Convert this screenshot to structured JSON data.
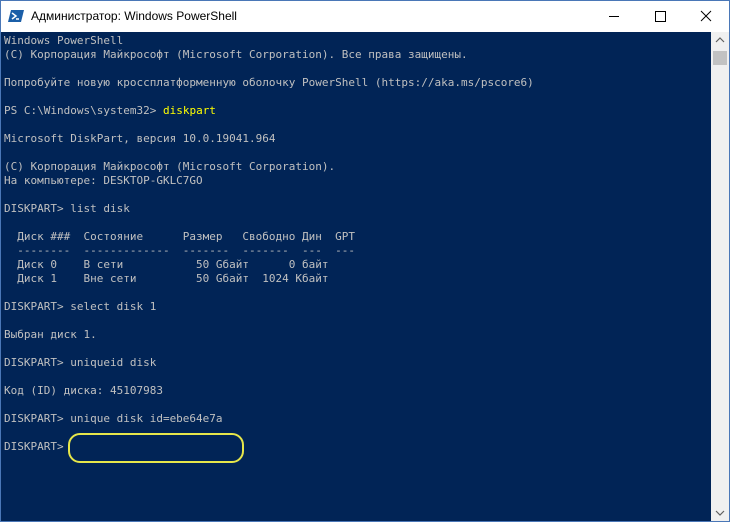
{
  "window": {
    "title": "Администратор: Windows PowerShell"
  },
  "icons": {
    "app": "powershell-icon",
    "minimize": "minimize-icon",
    "maximize": "maximize-icon",
    "close": "close-icon",
    "scroll_up": "chevron-up-icon",
    "scroll_down": "chevron-down-icon"
  },
  "colors": {
    "console_background": "#012456",
    "console_text": "#c0c0c0",
    "command_text": "#ffff00",
    "highlight_ring": "#e6e64a"
  },
  "console": {
    "lines": [
      "Windows PowerShell",
      "(C) Корпорация Майкрософт (Microsoft Corporation). Все права защищены.",
      "",
      "Попробуйте новую кроссплатформенную оболочку PowerShell (https://aka.ms/pscore6)",
      "",
      "PS C:\\Windows\\system32> ",
      "",
      "Microsoft DiskPart, версия 10.0.19041.964",
      "",
      "(C) Корпорация Майкрософт (Microsoft Corporation).",
      "На компьютере: DESKTOP-GKLC7GO",
      "",
      "DISKPART> list disk",
      "",
      "  Диск ###  Состояние      Размер   Свободно Дин  GPT",
      "  --------  -------------  -------  -------  ---  ---",
      "  Диск 0    В сети           50 Gбайт      0 байт",
      "  Диск 1    Вне сети         50 Gбайт  1024 Kбайт",
      "",
      "DISKPART> select disk 1",
      "",
      "Выбран диск 1.",
      "",
      "DISKPART> uniqueid disk",
      "",
      "Код (ID) диска: 45107983",
      "",
      "DISKPART> unique disk id=ebe64e7a",
      "",
      "DISKPART>"
    ],
    "prompt_command": "diskpart"
  }
}
